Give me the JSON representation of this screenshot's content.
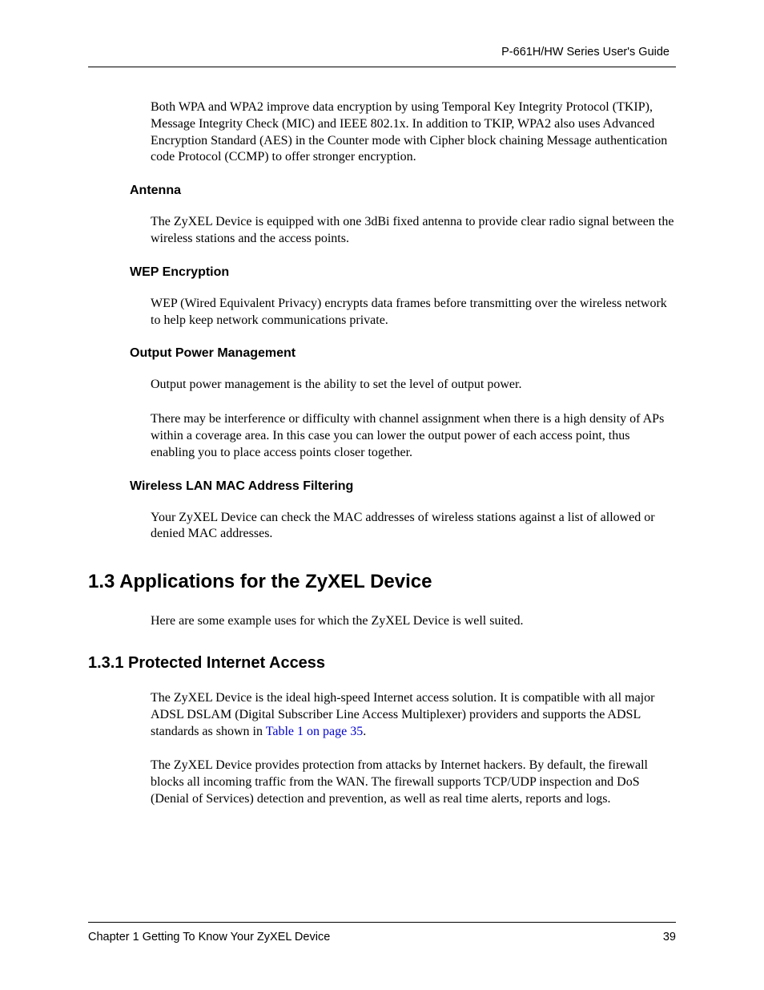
{
  "header": {
    "guide_title": "P-661H/HW Series User's Guide"
  },
  "content": {
    "intro_paragraph": "Both WPA and WPA2 improve data encryption by using Temporal Key Integrity Protocol (TKIP), Message Integrity Check (MIC) and IEEE 802.1x. In addition to TKIP, WPA2 also uses Advanced Encryption Standard (AES) in the Counter mode with Cipher block chaining Message authentication code Protocol (CCMP) to offer stronger encryption.",
    "sections": {
      "antenna": {
        "heading": "Antenna",
        "body": "The ZyXEL Device is equipped with one 3dBi fixed antenna to provide clear radio signal between the wireless stations and the access points."
      },
      "wep": {
        "heading": "WEP Encryption",
        "body": "WEP (Wired Equivalent Privacy) encrypts data frames before transmitting over the wireless network to help keep network communications private."
      },
      "output_power": {
        "heading": "Output Power Management",
        "body1": "Output power management is the ability to set the level of output power.",
        "body2": "There may be interference or difficulty with channel assignment when there is a high density of APs within a coverage area. In this case you can lower the output power of each access point, thus enabling you to place access points closer together."
      },
      "mac_filtering": {
        "heading": "Wireless LAN MAC Address Filtering",
        "body": "Your ZyXEL Device can check the MAC addresses of wireless stations against a list of allowed or denied MAC addresses."
      }
    },
    "major_section": {
      "heading": "1.3  Applications for the ZyXEL Device",
      "intro": "Here are some example uses for which the ZyXEL Device is well suited."
    },
    "subsection": {
      "heading": "1.3.1  Protected Internet Access",
      "body1_pre": "The ZyXEL Device is the ideal high-speed Internet access solution. It is compatible with all major ADSL DSLAM (Digital Subscriber Line Access Multiplexer) providers and supports the ADSL standards as shown in ",
      "body1_link": "Table 1 on page 35",
      "body1_post": ".",
      "body2": "The ZyXEL Device provides protection from attacks by Internet hackers. By default, the firewall blocks all incoming traffic from the WAN. The firewall supports TCP/UDP inspection and DoS (Denial of Services) detection and prevention, as well as real time alerts, reports and logs."
    }
  },
  "footer": {
    "chapter_text": "Chapter 1 Getting To Know Your ZyXEL Device",
    "page_number": "39"
  }
}
